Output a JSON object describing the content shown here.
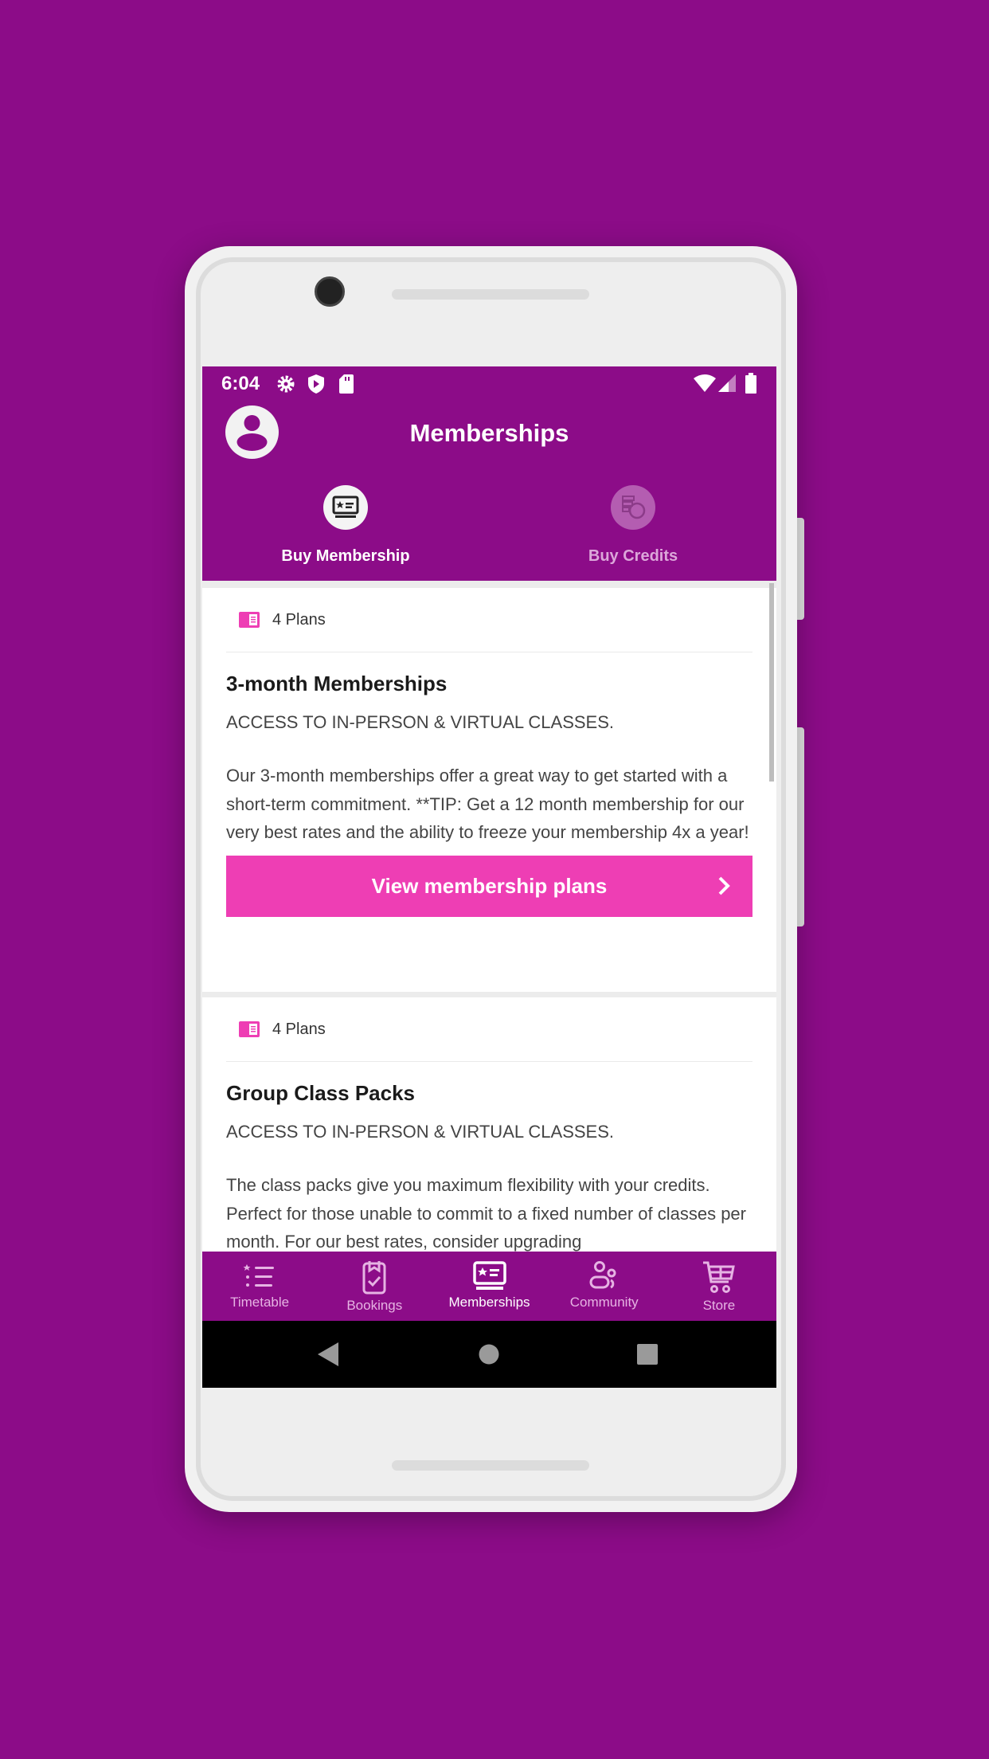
{
  "status_bar": {
    "time": "6:04",
    "icons": [
      "gear-icon",
      "shield-play-icon",
      "sd-card-icon",
      "wifi-icon",
      "signal-icon",
      "battery-icon"
    ]
  },
  "header": {
    "title": "Memberships",
    "avatar_icon": "user-icon"
  },
  "tabs": [
    {
      "label": "Buy Membership",
      "icon": "membership-card-icon",
      "active": true
    },
    {
      "label": "Buy Credits",
      "icon": "credits-coins-icon",
      "active": false
    }
  ],
  "cards": [
    {
      "plans": "4 Plans",
      "title": "3-month Memberships",
      "access": "ACCESS TO IN-PERSON & VIRTUAL CLASSES.",
      "description": "Our 3-month memberships offer a great way to get started with a short-term commitment. **TIP: Get a 12 month membership for our very best rates and the ability to freeze your membership 4x a year!",
      "button": "View membership plans"
    },
    {
      "plans": "4 Plans",
      "title": "Group Class Packs",
      "access": "ACCESS TO IN-PERSON & VIRTUAL CLASSES.",
      "description": "The class packs give you maximum flexibility with your credits. Perfect for those unable to commit to a fixed number of classes per month. For our best rates, consider upgrading"
    }
  ],
  "bottom_nav": [
    {
      "label": "Timetable",
      "icon": "list-icon"
    },
    {
      "label": "Bookings",
      "icon": "clipboard-check-icon"
    },
    {
      "label": "Memberships",
      "icon": "membership-card-icon",
      "active": true
    },
    {
      "label": "Community",
      "icon": "people-icon"
    },
    {
      "label": "Store",
      "icon": "cart-icon"
    }
  ],
  "colors": {
    "brand": "#8c0c88",
    "accent": "#ee3eb4"
  }
}
